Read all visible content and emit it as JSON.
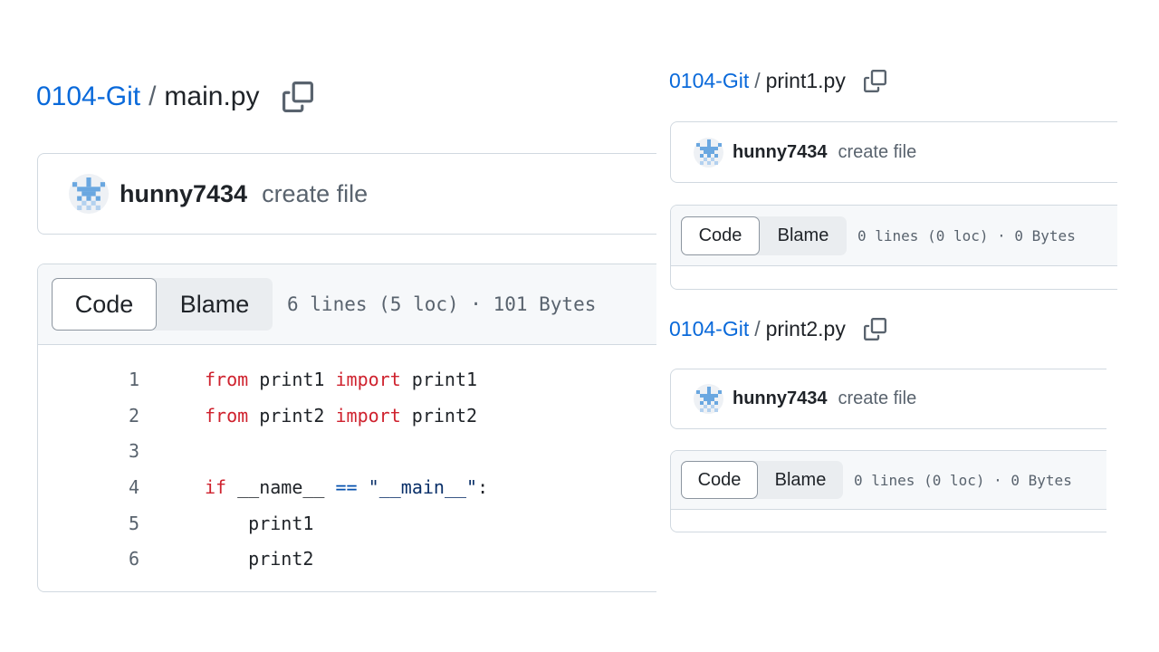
{
  "main": {
    "breadcrumb": {
      "repo": "0104-Git",
      "separator": "/",
      "file": "main.py"
    },
    "commit": {
      "author": "hunny7434",
      "message": "create file"
    },
    "tabs": {
      "code": "Code",
      "blame": "Blame"
    },
    "stats": "6 lines (5 loc) · 101 Bytes",
    "code_lines": [
      {
        "num": "1",
        "tokens": [
          {
            "t": "from",
            "c": "kw"
          },
          {
            "t": " print1 "
          },
          {
            "t": "import",
            "c": "kw"
          },
          {
            "t": " print1"
          }
        ]
      },
      {
        "num": "2",
        "tokens": [
          {
            "t": "from",
            "c": "kw"
          },
          {
            "t": " print2 "
          },
          {
            "t": "import",
            "c": "kw"
          },
          {
            "t": " print2"
          }
        ]
      },
      {
        "num": "3",
        "tokens": []
      },
      {
        "num": "4",
        "tokens": [
          {
            "t": "if",
            "c": "kw"
          },
          {
            "t": " __name__ "
          },
          {
            "t": "==",
            "c": "op"
          },
          {
            "t": " "
          },
          {
            "t": "\"__main__\"",
            "c": "str"
          },
          {
            "t": ":"
          }
        ]
      },
      {
        "num": "5",
        "tokens": [
          {
            "t": "    print1"
          }
        ]
      },
      {
        "num": "6",
        "tokens": [
          {
            "t": "    print2"
          }
        ]
      }
    ]
  },
  "print1": {
    "breadcrumb": {
      "repo": "0104-Git",
      "separator": "/",
      "file": "print1.py"
    },
    "commit": {
      "author": "hunny7434",
      "message": "create file"
    },
    "tabs": {
      "code": "Code",
      "blame": "Blame"
    },
    "stats": "0 lines (0 loc) · 0 Bytes"
  },
  "print2": {
    "breadcrumb": {
      "repo": "0104-Git",
      "separator": "/",
      "file": "print2.py"
    },
    "commit": {
      "author": "hunny7434",
      "message": "create file"
    },
    "tabs": {
      "code": "Code",
      "blame": "Blame"
    },
    "stats": "0 lines (0 loc) · 0 Bytes"
  },
  "icons": {
    "copy": "copy-icon",
    "avatar": "identicon-avatar"
  },
  "colors": {
    "link": "#0969da",
    "keyword": "#cf222e",
    "operator": "#0550ae",
    "string": "#0a3069",
    "border": "#d1d9e0",
    "header_bg": "#f6f8fa"
  }
}
